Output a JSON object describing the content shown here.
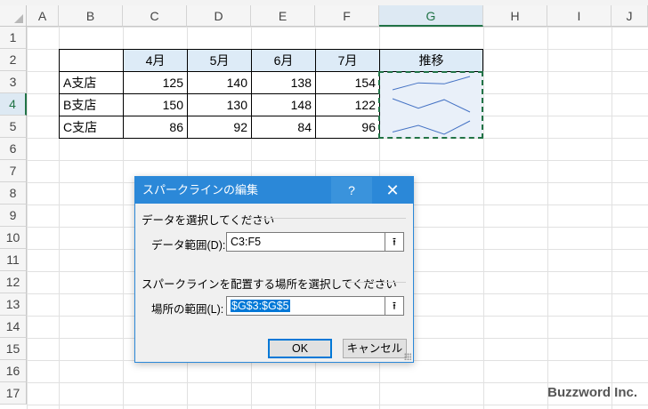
{
  "columns": [
    "A",
    "B",
    "C",
    "D",
    "E",
    "F",
    "G",
    "H",
    "I",
    "J"
  ],
  "rows": [
    "1",
    "2",
    "3",
    "4",
    "5",
    "6",
    "7",
    "8",
    "9",
    "10",
    "11",
    "12",
    "13",
    "14",
    "15",
    "16",
    "17"
  ],
  "table": {
    "header": [
      "",
      "4月",
      "5月",
      "6月",
      "7月",
      "推移"
    ],
    "rows": [
      {
        "name": "A支店",
        "values": [
          "125",
          "140",
          "138",
          "154"
        ]
      },
      {
        "name": "B支店",
        "values": [
          "150",
          "130",
          "148",
          "122"
        ]
      },
      {
        "name": "C支店",
        "values": [
          "86",
          "92",
          "84",
          "96"
        ]
      }
    ]
  },
  "dialog": {
    "title": "スパークラインの編集",
    "help_label": "?",
    "close_label": "✕",
    "section1": "データを選択してください",
    "data_range_label": "データ範囲(D):",
    "data_range_value": "C3:F5",
    "section2": "スパークラインを配置する場所を選択してください",
    "location_label": "場所の範囲(L):",
    "location_value": "$G$3:$G$5",
    "collapse_icon": "⭱",
    "ok_label": "OK",
    "cancel_label": "キャンセル"
  },
  "watermark": "Buzzword Inc.",
  "colors": {
    "accent": "#217346",
    "dialog_title": "#2b88d8",
    "header_fill": "#ddebf7",
    "sparkline": "#4472c4"
  }
}
